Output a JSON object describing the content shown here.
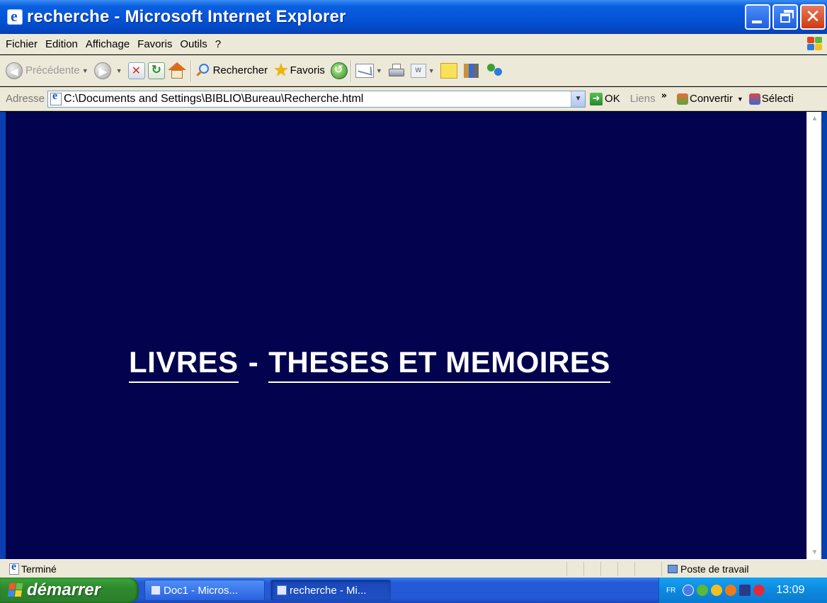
{
  "window": {
    "title": "recherche - Microsoft Internet Explorer"
  },
  "menu": [
    "Fichier",
    "Edition",
    "Affichage",
    "Favoris",
    "Outils",
    "?"
  ],
  "toolbar": {
    "back_label": "Précédente",
    "search_label": "Rechercher",
    "favorites_label": "Favoris",
    "edit_label": "W"
  },
  "address": {
    "label": "Adresse",
    "url": "C:\\Documents and Settings\\BIBLIO\\Bureau\\Recherche.html",
    "go_label": "OK",
    "links_label": "Liens",
    "chevron": "»",
    "convert_label": "Convertir",
    "select_label": "Sélecti"
  },
  "content": {
    "link_books": "LIVRES",
    "separator": "-",
    "link_theses": "THESES ET MEMOIRES",
    "background": "#02024e"
  },
  "status": {
    "text": "Terminé",
    "zone": "Poste de travail"
  },
  "taskbar": {
    "start_label": "démarrer",
    "tasks": [
      {
        "label": "Doc1 - Micros..."
      },
      {
        "label": "recherche - Mi..."
      }
    ],
    "lang": "FR",
    "clock": "13:09"
  },
  "colors": {
    "xp_blue": "#0454d8",
    "start_green": "#2e8a2e",
    "tray_blue": "#0c8ae0"
  }
}
